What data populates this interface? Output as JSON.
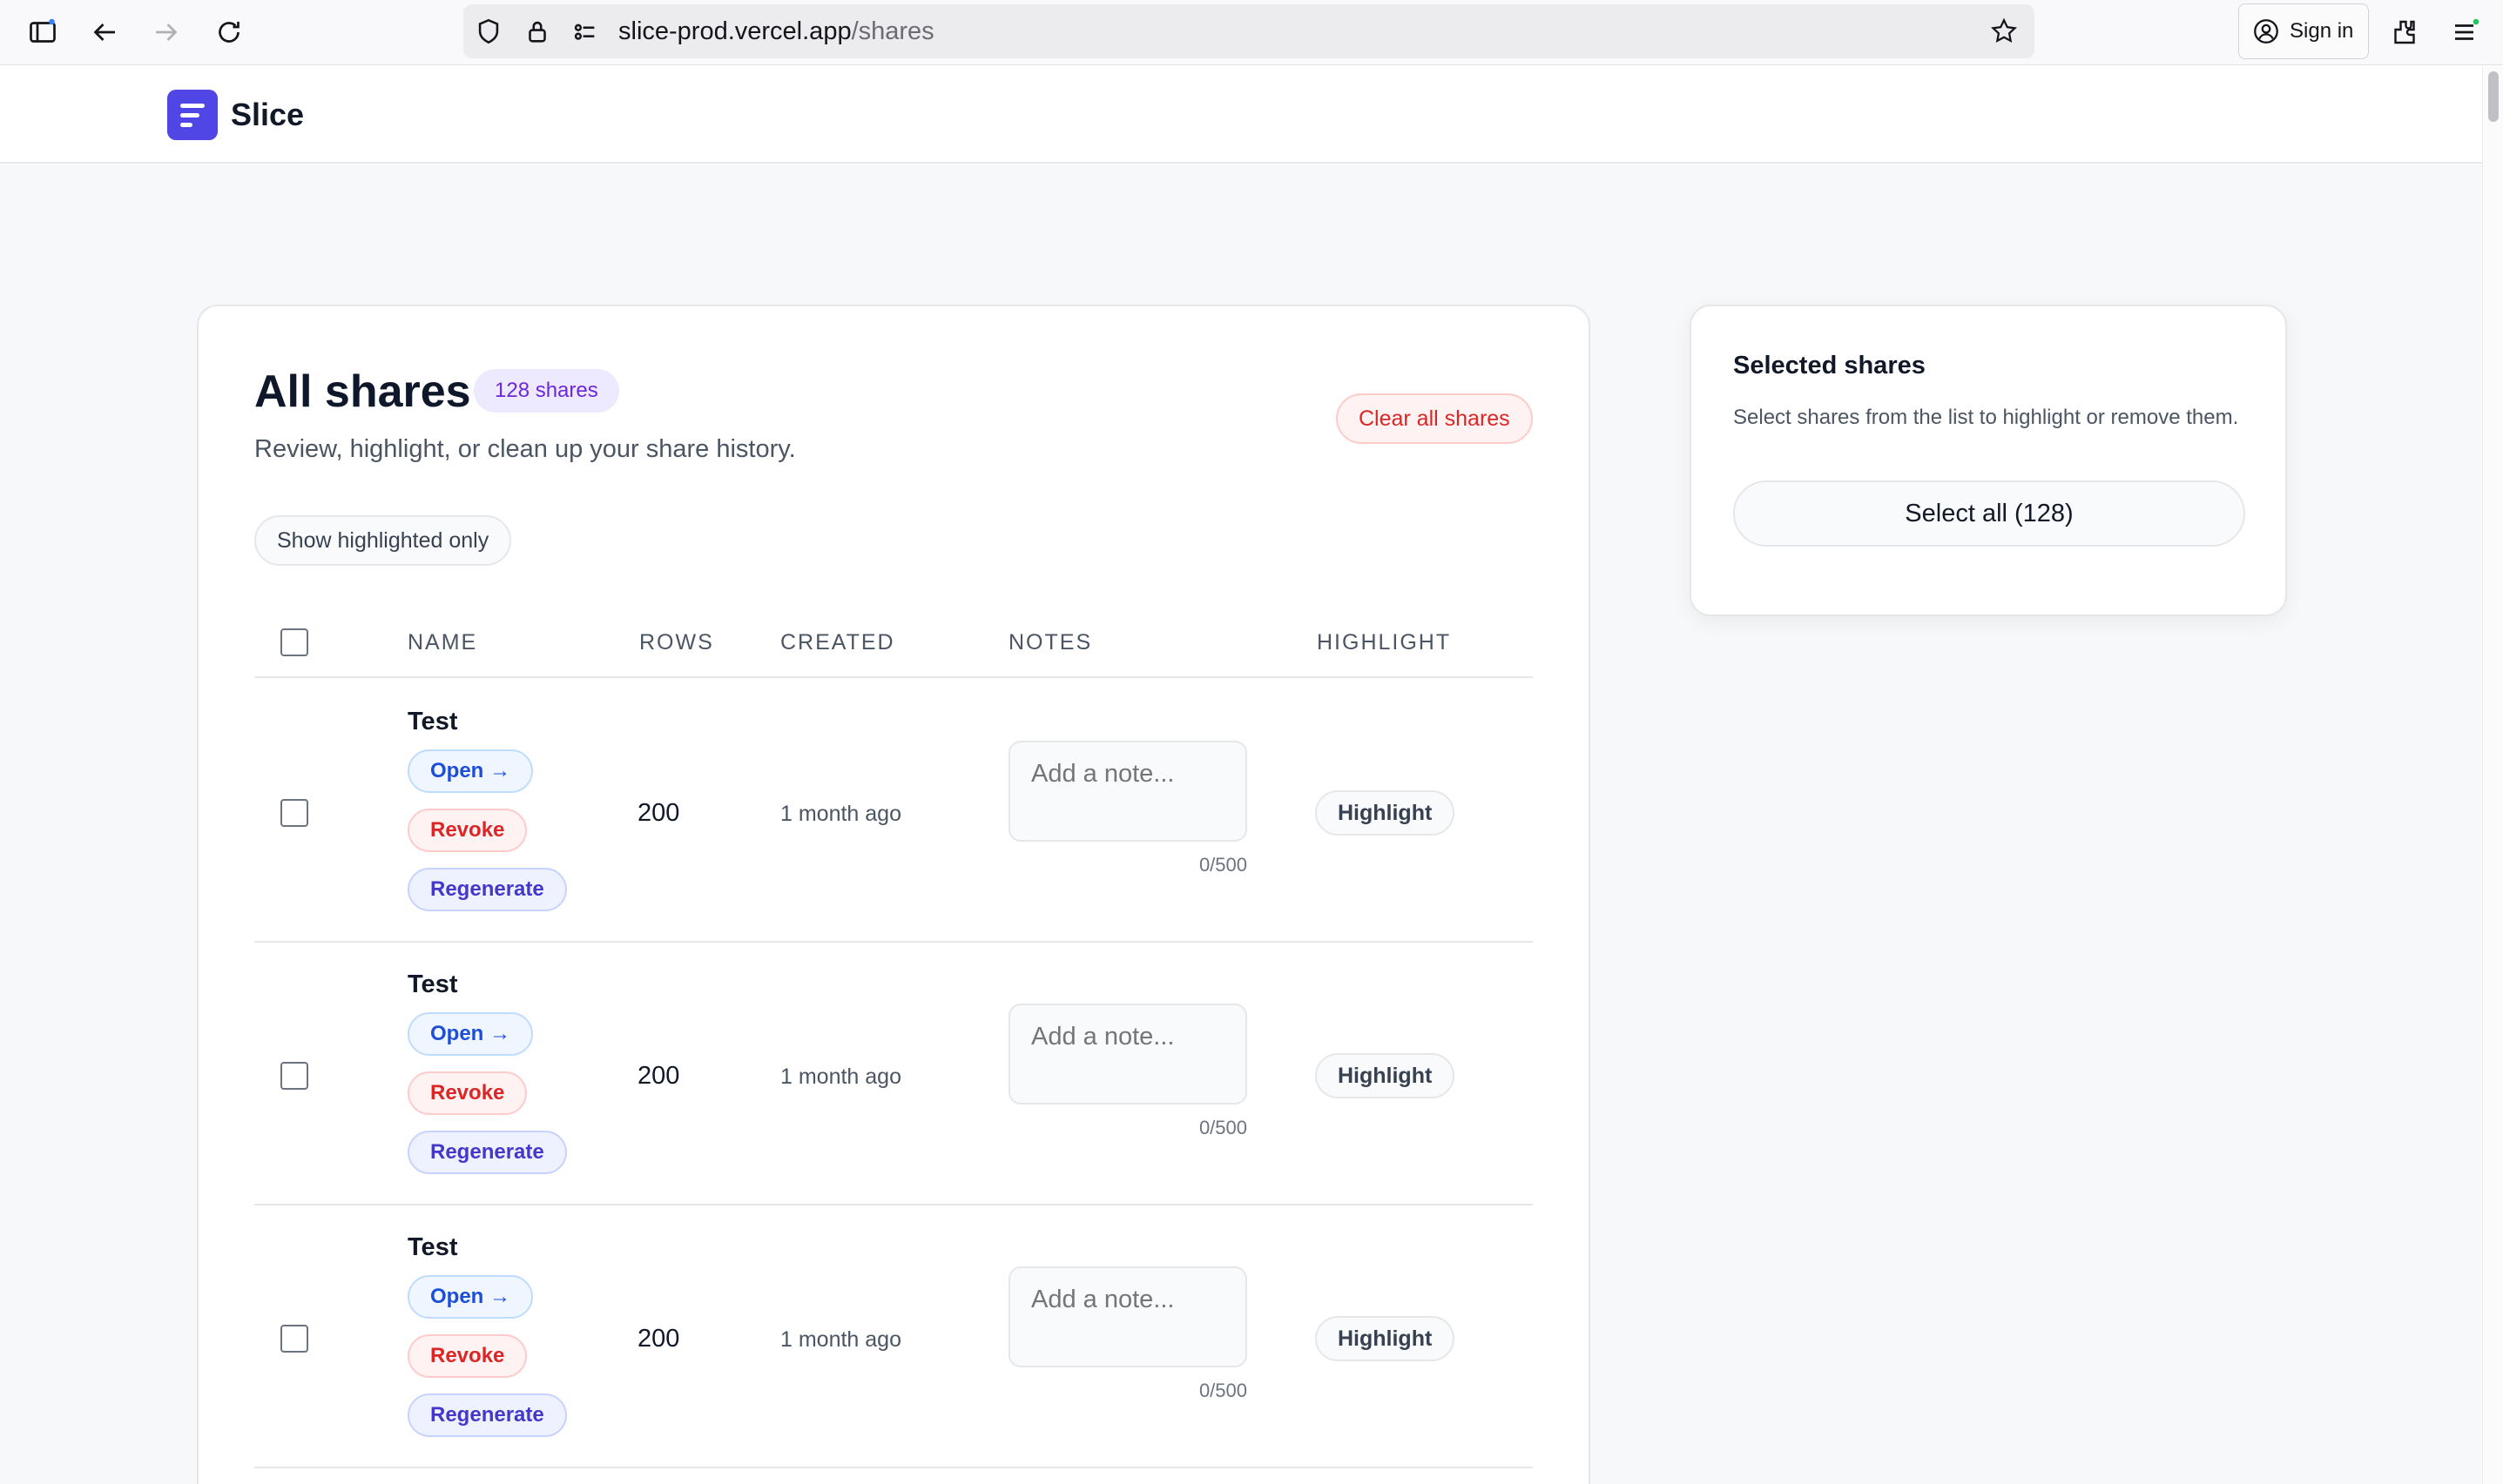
{
  "browser": {
    "url_host": "slice-prod.vercel.app",
    "url_path": "/shares",
    "signin_label": "Sign in",
    "icons": [
      "sidebar-icon",
      "back-icon",
      "forward-icon",
      "reload-icon",
      "shield-icon",
      "lock-icon",
      "permissions-icon",
      "star-icon",
      "account-icon",
      "extensions-icon",
      "menu-icon"
    ]
  },
  "app": {
    "brand": "Slice"
  },
  "shares": {
    "title": "All shares",
    "count_badge": "128 shares",
    "subtitle": "Review, highlight, or clean up your share history.",
    "clear_label": "Clear all shares",
    "filter_label": "Show highlighted only",
    "columns": {
      "name": "NAME",
      "rows": "ROWS",
      "created": "CREATED",
      "notes": "NOTES",
      "highlight": "HIGHLIGHT"
    },
    "rows": [
      {
        "name": "Test",
        "open": "Open →",
        "revoke": "Revoke",
        "regenerate": "Regenerate",
        "rows": "200",
        "created": "1 month ago",
        "note_placeholder": "Add a note...",
        "note_count": "0/500",
        "highlight": "Highlight"
      },
      {
        "name": "Test",
        "open": "Open →",
        "revoke": "Revoke",
        "regenerate": "Regenerate",
        "rows": "200",
        "created": "1 month ago",
        "note_placeholder": "Add a note...",
        "note_count": "0/500",
        "highlight": "Highlight"
      },
      {
        "name": "Test",
        "open": "Open →",
        "revoke": "Revoke",
        "regenerate": "Regenerate",
        "rows": "200",
        "created": "1 month ago",
        "note_placeholder": "Add a note...",
        "note_count": "0/500",
        "highlight": "Highlight"
      }
    ]
  },
  "selected": {
    "title": "Selected shares",
    "description": "Select shares from the list to highlight or remove them.",
    "select_all_label": "Select all (128)"
  }
}
